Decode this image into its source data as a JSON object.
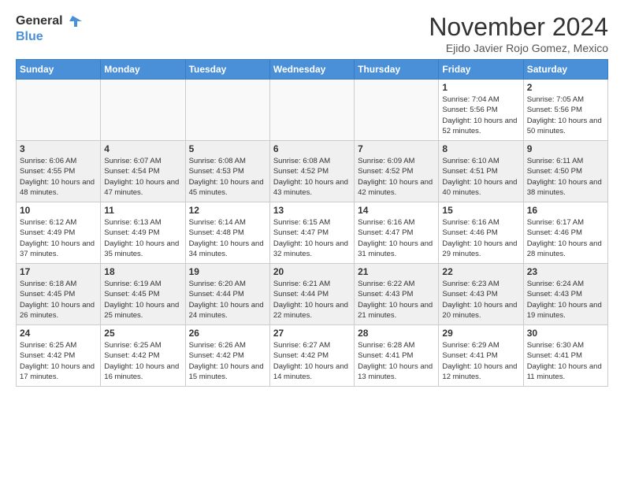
{
  "logo": {
    "line1": "General",
    "line2": "Blue"
  },
  "title": "November 2024",
  "location": "Ejido Javier Rojo Gomez, Mexico",
  "weekdays": [
    "Sunday",
    "Monday",
    "Tuesday",
    "Wednesday",
    "Thursday",
    "Friday",
    "Saturday"
  ],
  "weeks": [
    [
      {
        "day": "",
        "empty": true
      },
      {
        "day": "",
        "empty": true
      },
      {
        "day": "",
        "empty": true
      },
      {
        "day": "",
        "empty": true
      },
      {
        "day": "",
        "empty": true
      },
      {
        "day": "1",
        "sunrise": "Sunrise: 7:04 AM",
        "sunset": "Sunset: 5:56 PM",
        "daylight": "Daylight: 10 hours and 52 minutes."
      },
      {
        "day": "2",
        "sunrise": "Sunrise: 7:05 AM",
        "sunset": "Sunset: 5:56 PM",
        "daylight": "Daylight: 10 hours and 50 minutes."
      }
    ],
    [
      {
        "day": "3",
        "sunrise": "Sunrise: 6:06 AM",
        "sunset": "Sunset: 4:55 PM",
        "daylight": "Daylight: 10 hours and 48 minutes."
      },
      {
        "day": "4",
        "sunrise": "Sunrise: 6:07 AM",
        "sunset": "Sunset: 4:54 PM",
        "daylight": "Daylight: 10 hours and 47 minutes."
      },
      {
        "day": "5",
        "sunrise": "Sunrise: 6:08 AM",
        "sunset": "Sunset: 4:53 PM",
        "daylight": "Daylight: 10 hours and 45 minutes."
      },
      {
        "day": "6",
        "sunrise": "Sunrise: 6:08 AM",
        "sunset": "Sunset: 4:52 PM",
        "daylight": "Daylight: 10 hours and 43 minutes."
      },
      {
        "day": "7",
        "sunrise": "Sunrise: 6:09 AM",
        "sunset": "Sunset: 4:52 PM",
        "daylight": "Daylight: 10 hours and 42 minutes."
      },
      {
        "day": "8",
        "sunrise": "Sunrise: 6:10 AM",
        "sunset": "Sunset: 4:51 PM",
        "daylight": "Daylight: 10 hours and 40 minutes."
      },
      {
        "day": "9",
        "sunrise": "Sunrise: 6:11 AM",
        "sunset": "Sunset: 4:50 PM",
        "daylight": "Daylight: 10 hours and 38 minutes."
      }
    ],
    [
      {
        "day": "10",
        "sunrise": "Sunrise: 6:12 AM",
        "sunset": "Sunset: 4:49 PM",
        "daylight": "Daylight: 10 hours and 37 minutes."
      },
      {
        "day": "11",
        "sunrise": "Sunrise: 6:13 AM",
        "sunset": "Sunset: 4:49 PM",
        "daylight": "Daylight: 10 hours and 35 minutes."
      },
      {
        "day": "12",
        "sunrise": "Sunrise: 6:14 AM",
        "sunset": "Sunset: 4:48 PM",
        "daylight": "Daylight: 10 hours and 34 minutes."
      },
      {
        "day": "13",
        "sunrise": "Sunrise: 6:15 AM",
        "sunset": "Sunset: 4:47 PM",
        "daylight": "Daylight: 10 hours and 32 minutes."
      },
      {
        "day": "14",
        "sunrise": "Sunrise: 6:16 AM",
        "sunset": "Sunset: 4:47 PM",
        "daylight": "Daylight: 10 hours and 31 minutes."
      },
      {
        "day": "15",
        "sunrise": "Sunrise: 6:16 AM",
        "sunset": "Sunset: 4:46 PM",
        "daylight": "Daylight: 10 hours and 29 minutes."
      },
      {
        "day": "16",
        "sunrise": "Sunrise: 6:17 AM",
        "sunset": "Sunset: 4:46 PM",
        "daylight": "Daylight: 10 hours and 28 minutes."
      }
    ],
    [
      {
        "day": "17",
        "sunrise": "Sunrise: 6:18 AM",
        "sunset": "Sunset: 4:45 PM",
        "daylight": "Daylight: 10 hours and 26 minutes."
      },
      {
        "day": "18",
        "sunrise": "Sunrise: 6:19 AM",
        "sunset": "Sunset: 4:45 PM",
        "daylight": "Daylight: 10 hours and 25 minutes."
      },
      {
        "day": "19",
        "sunrise": "Sunrise: 6:20 AM",
        "sunset": "Sunset: 4:44 PM",
        "daylight": "Daylight: 10 hours and 24 minutes."
      },
      {
        "day": "20",
        "sunrise": "Sunrise: 6:21 AM",
        "sunset": "Sunset: 4:44 PM",
        "daylight": "Daylight: 10 hours and 22 minutes."
      },
      {
        "day": "21",
        "sunrise": "Sunrise: 6:22 AM",
        "sunset": "Sunset: 4:43 PM",
        "daylight": "Daylight: 10 hours and 21 minutes."
      },
      {
        "day": "22",
        "sunrise": "Sunrise: 6:23 AM",
        "sunset": "Sunset: 4:43 PM",
        "daylight": "Daylight: 10 hours and 20 minutes."
      },
      {
        "day": "23",
        "sunrise": "Sunrise: 6:24 AM",
        "sunset": "Sunset: 4:43 PM",
        "daylight": "Daylight: 10 hours and 19 minutes."
      }
    ],
    [
      {
        "day": "24",
        "sunrise": "Sunrise: 6:25 AM",
        "sunset": "Sunset: 4:42 PM",
        "daylight": "Daylight: 10 hours and 17 minutes."
      },
      {
        "day": "25",
        "sunrise": "Sunrise: 6:25 AM",
        "sunset": "Sunset: 4:42 PM",
        "daylight": "Daylight: 10 hours and 16 minutes."
      },
      {
        "day": "26",
        "sunrise": "Sunrise: 6:26 AM",
        "sunset": "Sunset: 4:42 PM",
        "daylight": "Daylight: 10 hours and 15 minutes."
      },
      {
        "day": "27",
        "sunrise": "Sunrise: 6:27 AM",
        "sunset": "Sunset: 4:42 PM",
        "daylight": "Daylight: 10 hours and 14 minutes."
      },
      {
        "day": "28",
        "sunrise": "Sunrise: 6:28 AM",
        "sunset": "Sunset: 4:41 PM",
        "daylight": "Daylight: 10 hours and 13 minutes."
      },
      {
        "day": "29",
        "sunrise": "Sunrise: 6:29 AM",
        "sunset": "Sunset: 4:41 PM",
        "daylight": "Daylight: 10 hours and 12 minutes."
      },
      {
        "day": "30",
        "sunrise": "Sunrise: 6:30 AM",
        "sunset": "Sunset: 4:41 PM",
        "daylight": "Daylight: 10 hours and 11 minutes."
      }
    ]
  ]
}
